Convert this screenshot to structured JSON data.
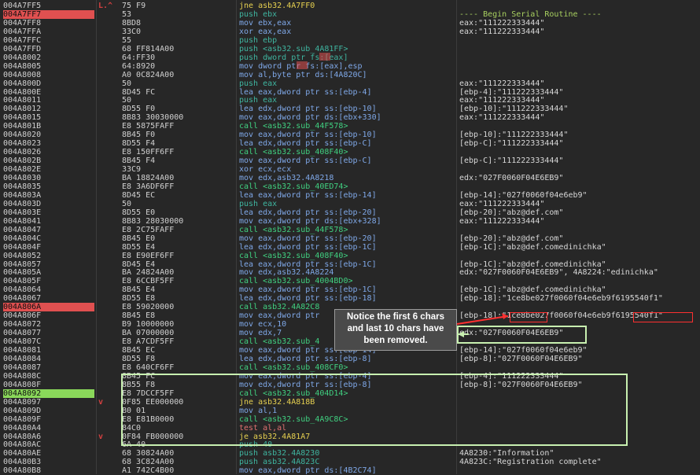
{
  "rows": [
    {
      "a": "004A7FF5",
      "m": "L.^",
      "b": "75 F9",
      "i": "jne asb32.4A7FF0",
      "k": "jmp",
      "c": ""
    },
    {
      "a": "004A7FF7",
      "m": "",
      "b": "53",
      "i": "push ebx",
      "k": "push",
      "c": "---- Begin Serial Routine ----",
      "ch": 1
    },
    {
      "a": "004A7FF8",
      "m": "",
      "b": "8BD8",
      "i": "mov ebx,eax",
      "k": "mov",
      "c": "eax:\"111222333444\""
    },
    {
      "a": "004A7FFA",
      "m": "",
      "b": "33C0",
      "i": "xor eax,eax",
      "k": "mov",
      "c": "eax:\"111222333444\""
    },
    {
      "a": "004A7FFC",
      "m": "",
      "b": "55",
      "i": "push ebp",
      "k": "push",
      "c": ""
    },
    {
      "a": "004A7FFD",
      "m": "",
      "b": "68 FF814A00",
      "i": "push <asb32.sub_4A81FF>",
      "k": "push",
      "c": ""
    },
    {
      "a": "004A8002",
      "m": "",
      "b": "64:FF30",
      "i": "push dword ptr fs:[eax]",
      "k": "push",
      "c": ""
    },
    {
      "a": "004A8005",
      "m": "",
      "b": "64:8920",
      "i": "mov dword ptr fs:[eax],esp",
      "k": "mov",
      "c": ""
    },
    {
      "a": "004A8008",
      "m": "",
      "b": "A0 0C824A00",
      "i": "mov al,byte ptr ds:[4A820C]",
      "k": "mov",
      "c": ""
    },
    {
      "a": "004A800D",
      "m": "",
      "b": "50",
      "i": "push eax",
      "k": "push",
      "c": "eax:\"111222333444\""
    },
    {
      "a": "004A800E",
      "m": "",
      "b": "8D45 FC",
      "i": "lea eax,dword ptr ss:[ebp-4]",
      "k": "mov",
      "c": "[ebp-4]:\"111222333444\""
    },
    {
      "a": "004A8011",
      "m": "",
      "b": "50",
      "i": "push eax",
      "k": "push",
      "c": "eax:\"111222333444\""
    },
    {
      "a": "004A8012",
      "m": "",
      "b": "8D55 F0",
      "i": "lea edx,dword ptr ss:[ebp-10]",
      "k": "mov",
      "c": "[ebp-10]:\"111222333444\""
    },
    {
      "a": "004A8015",
      "m": "",
      "b": "8B83 30030000",
      "i": "mov eax,dword ptr ds:[ebx+330]",
      "k": "mov",
      "c": "eax:\"111222333444\""
    },
    {
      "a": "004A801B",
      "m": "",
      "b": "E8 5875FAFF",
      "i": "call <asb32.sub_44F578>",
      "k": "call",
      "c": ""
    },
    {
      "a": "004A8020",
      "m": "",
      "b": "8B45 F0",
      "i": "mov eax,dword ptr ss:[ebp-10]",
      "k": "mov",
      "c": "[ebp-10]:\"111222333444\""
    },
    {
      "a": "004A8023",
      "m": "",
      "b": "8D55 F4",
      "i": "lea edx,dword ptr ss:[ebp-C]",
      "k": "mov",
      "c": "[ebp-C]:\"111222333444\""
    },
    {
      "a": "004A8026",
      "m": "",
      "b": "E8 150FF6FF",
      "i": "call <asb32.sub_408F40>",
      "k": "call",
      "c": ""
    },
    {
      "a": "004A802B",
      "m": "",
      "b": "8B45 F4",
      "i": "mov eax,dword ptr ss:[ebp-C]",
      "k": "mov",
      "c": "[ebp-C]:\"111222333444\""
    },
    {
      "a": "004A802E",
      "m": "",
      "b": "33C9",
      "i": "xor ecx,ecx",
      "k": "mov",
      "c": ""
    },
    {
      "a": "004A8030",
      "m": "",
      "b": "BA 18824A00",
      "i": "mov edx,asb32.4A8218",
      "k": "mov",
      "c": "edx:\"027F0060F04E6EB9\""
    },
    {
      "a": "004A8035",
      "m": "",
      "b": "E8 3A6DF6FF",
      "i": "call <asb32.sub_40ED74>",
      "k": "call",
      "c": ""
    },
    {
      "a": "004A803A",
      "m": "",
      "b": "8D45 EC",
      "i": "lea eax,dword ptr ss:[ebp-14]",
      "k": "mov",
      "c": "[ebp-14]:\"027f0060f04e6eb9\""
    },
    {
      "a": "004A803D",
      "m": "",
      "b": "50",
      "i": "push eax",
      "k": "push",
      "c": "eax:\"111222333444\""
    },
    {
      "a": "004A803E",
      "m": "",
      "b": "8D55 E0",
      "i": "lea edx,dword ptr ss:[ebp-20]",
      "k": "mov",
      "c": "[ebp-20]:\"abz@def.com\""
    },
    {
      "a": "004A8041",
      "m": "",
      "b": "8B83 28030000",
      "i": "mov eax,dword ptr ds:[ebx+328]",
      "k": "mov",
      "c": "eax:\"111222333444\""
    },
    {
      "a": "004A8047",
      "m": "",
      "b": "E8 2C75FAFF",
      "i": "call <asb32.sub_44F578>",
      "k": "call",
      "c": ""
    },
    {
      "a": "004A804C",
      "m": "",
      "b": "8B45 E0",
      "i": "mov eax,dword ptr ss:[ebp-20]",
      "k": "mov",
      "c": "[ebp-20]:\"abz@def.com\""
    },
    {
      "a": "004A804F",
      "m": "",
      "b": "8D55 E4",
      "i": "lea edx,dword ptr ss:[ebp-1C]",
      "k": "mov",
      "c": "[ebp-1C]:\"abz@def.comedinichka\""
    },
    {
      "a": "004A8052",
      "m": "",
      "b": "E8 E90EF6FF",
      "i": "call <asb32.sub_408F40>",
      "k": "call",
      "c": ""
    },
    {
      "a": "004A8057",
      "m": "",
      "b": "8D45 E4",
      "i": "lea eax,dword ptr ss:[ebp-1C]",
      "k": "mov",
      "c": "[ebp-1C]:\"abz@def.comedinichka\""
    },
    {
      "a": "004A805A",
      "m": "",
      "b": "BA 24824A00",
      "i": "mov edx,asb32.4A8224",
      "k": "mov",
      "c": "edx:\"027F0060F04E6EB9\", 4A8224:\"edinichka\""
    },
    {
      "a": "004A805F",
      "m": "",
      "b": "E8 6CCBF5FF",
      "i": "call <asb32.sub_4004BD0>",
      "k": "call",
      "c": ""
    },
    {
      "a": "004A8064",
      "m": "",
      "b": "8B45 E4",
      "i": "mov eax,dword ptr ss:[ebp-1C]",
      "k": "mov",
      "c": "[ebp-1C]:\"abz@def.comedinichka\""
    },
    {
      "a": "004A8067",
      "m": "",
      "b": "8D55 E8",
      "i": "lea edx,dword ptr ss:[ebp-18]",
      "k": "mov",
      "c": "[ebp-18]:\"1ce8be027f0060f04e6eb9f6195540f1\""
    },
    {
      "a": "004A806A",
      "m": "",
      "b": "E8 59020000",
      "i": "call asb32.4A82C8",
      "k": "call",
      "c": "",
      "hl": "red"
    },
    {
      "a": "004A806F",
      "m": "",
      "b": "8B45 E8",
      "i": "mov eax,dword ptr",
      "k": "mov",
      "c": "[ebp-18]:\"1ce8be027f0060f04e6eb9f6195540f1\""
    },
    {
      "a": "004A8072",
      "m": "",
      "b": "B9 10000000",
      "i": "mov ecx,10",
      "k": "mov",
      "c": ""
    },
    {
      "a": "004A8077",
      "m": "",
      "b": "BA 07000000",
      "i": "mov edx,7",
      "k": "mov",
      "c": "edx:\"027F0060F04E6EB9\""
    },
    {
      "a": "004A807C",
      "m": "",
      "b": "E8 A7CDF5FF",
      "i": "call <asb32.sub_4",
      "k": "call",
      "c": ""
    },
    {
      "a": "004A8081",
      "m": "",
      "b": "8B45 EC",
      "i": "mov eax,dword ptr ss:[ebp-14]",
      "k": "mov",
      "c": "[ebp-14]:\"027f0060f04e6eb9\""
    },
    {
      "a": "004A8084",
      "m": "",
      "b": "8D55 F8",
      "i": "lea edx,dword ptr ss:[ebp-8]",
      "k": "mov",
      "c": "[ebp-8]:\"027F0060F04E6EB9\""
    },
    {
      "a": "004A8087",
      "m": "",
      "b": "E8 640CF6FF",
      "i": "call <asb32.sub_408CF0>",
      "k": "call",
      "c": ""
    },
    {
      "a": "004A808C",
      "m": "",
      "b": "8B45 FC",
      "i": "mov eax,dword ptr ss:[ebp-4]",
      "k": "mov",
      "c": "[ebp-4]:\"111222333444\""
    },
    {
      "a": "004A808F",
      "m": "",
      "b": "8B55 F8",
      "i": "mov edx,dword ptr ss:[ebp-8]",
      "k": "mov",
      "c": "[ebp-8]:\"027F0060F04E6EB9\""
    },
    {
      "a": "004A8092",
      "m": "",
      "b": "E8 7DCCF5FF",
      "i": "call <asb32.sub_404D14>",
      "k": "call",
      "c": "",
      "hl": "green"
    },
    {
      "a": "004A8097",
      "m": "v",
      "b": "0F85 EE000000",
      "i": "jne asb32.4A818B",
      "k": "jmp",
      "c": ""
    },
    {
      "a": "004A809D",
      "m": "",
      "b": "B0 01",
      "i": "mov al,1",
      "k": "mov",
      "c": ""
    },
    {
      "a": "004A809F",
      "m": "",
      "b": "E8 E81B0000",
      "i": "call <asb32.sub_4A9C8C>",
      "k": "call",
      "c": ""
    },
    {
      "a": "004A80A4",
      "m": "",
      "b": "84C0",
      "i": "test al,al",
      "k": "test",
      "c": ""
    },
    {
      "a": "004A80A6",
      "m": "v",
      "b": "0F84 FB000000",
      "i": "je asb32.4A81A7",
      "k": "jmp",
      "c": ""
    },
    {
      "a": "004A80AC",
      "m": "",
      "b": "6A 40",
      "i": "push 40",
      "k": "push",
      "c": ""
    },
    {
      "a": "004A80AE",
      "m": "",
      "b": "68 30824A00",
      "i": "push asb32.4A8230",
      "k": "push",
      "c": "4A8230:\"Information\""
    },
    {
      "a": "004A80B3",
      "m": "",
      "b": "68 3C824A00",
      "i": "push asb32.4A823C",
      "k": "push",
      "c": "4A823C:\"Registration complete\""
    },
    {
      "a": "004A80B8",
      "m": "",
      "b": "A1 742C4B00",
      "i": "mov eax,dword ptr ds:[4B2C74]",
      "k": "mov",
      "c": ""
    }
  ],
  "note": {
    "line1": "Notice the first 6 chars",
    "line2": "and last 10 chars have",
    "line3": "been removed."
  },
  "colors": {
    "background": "#272727",
    "highlight_red": "#e05050",
    "highlight_green": "#8ad85a",
    "annotation_border": "#c8f0b0",
    "annotation_red": "#ff3030"
  }
}
